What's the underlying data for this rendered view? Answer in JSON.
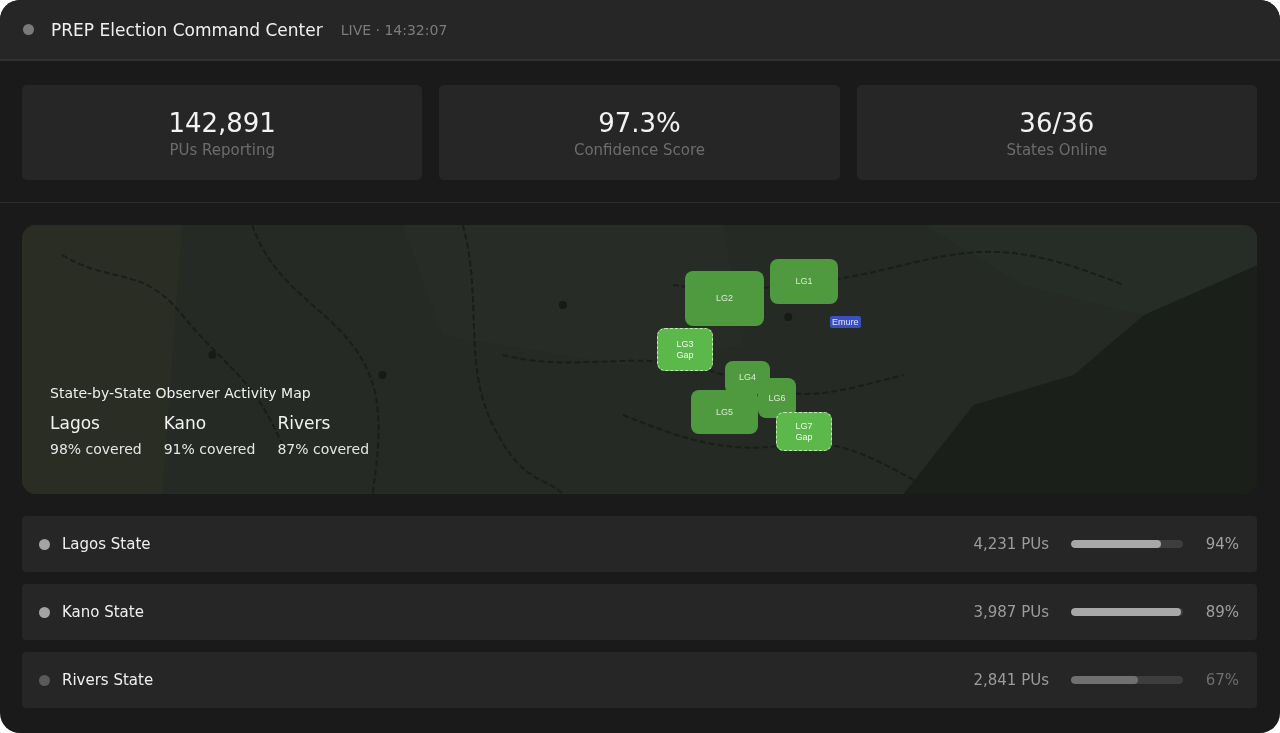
{
  "header": {
    "title": "PREP Election Command Center",
    "status": "LIVE · 14:32:07"
  },
  "stats": [
    {
      "value": "142,891",
      "label": "PUs Reporting"
    },
    {
      "value": "97.3%",
      "label": "Confidence Score"
    },
    {
      "value": "36/36",
      "label": "States Online"
    }
  ],
  "map": {
    "title": "State-by-State Observer Activity Map",
    "summaries": [
      {
        "name": "Lagos",
        "coverage": "98% covered"
      },
      {
        "name": "Kano",
        "coverage": "91% covered"
      },
      {
        "name": "Rivers",
        "coverage": "87% covered"
      }
    ],
    "zones": [
      {
        "label": "LG1",
        "gap": false
      },
      {
        "label": "LG2",
        "gap": false
      },
      {
        "label": "LG3",
        "note": "Gap",
        "gap": true
      },
      {
        "label": "LG6",
        "gap": false
      },
      {
        "label": "LG5",
        "gap": false
      },
      {
        "label": "LG4",
        "gap": false
      },
      {
        "label": "LG7",
        "note": "Gap",
        "gap": true
      }
    ],
    "tag": "Emure"
  },
  "states": [
    {
      "name": "Lagos State",
      "pus": "4,231 PUs",
      "level": 0.8,
      "percent": "94%",
      "active": true
    },
    {
      "name": "Kano State",
      "pus": "3,987 PUs",
      "level": 0.98,
      "percent": "89%",
      "active": true
    },
    {
      "name": "Rivers State",
      "pus": "2,841 PUs",
      "level": 0.6,
      "percent": "67%",
      "active": false
    }
  ]
}
